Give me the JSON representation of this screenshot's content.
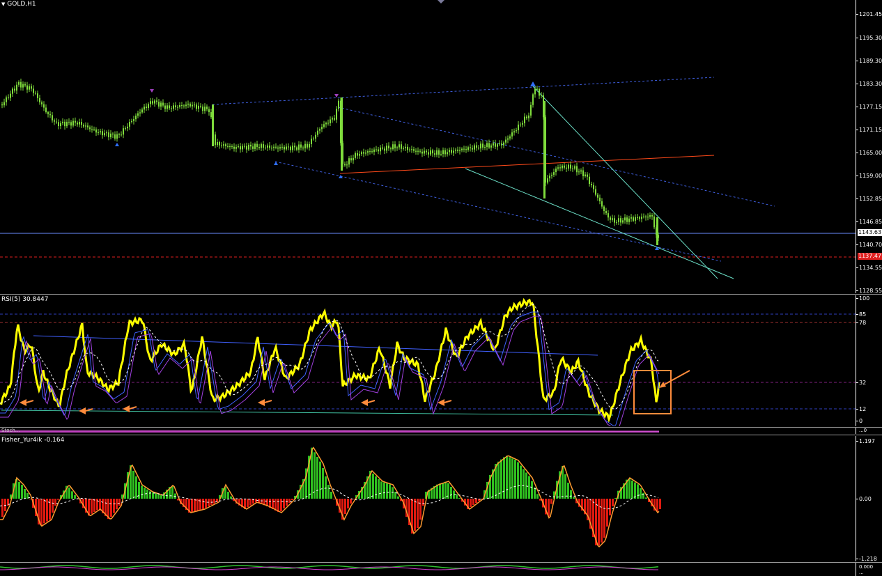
{
  "chart_window": {
    "menu_arrow": "dropdown-triangle",
    "symbol": "GOLD,H1"
  },
  "price_pane": {
    "price_ticks": [
      "1201.45",
      "1195.30",
      "1189.30",
      "1183.30",
      "1177.15",
      "1171.15",
      "1165.00",
      "1159.00",
      "1152.85",
      "1146.85",
      "1140.70",
      "1134.55",
      "1128.55"
    ],
    "current_price_label": "1143.63",
    "alert_price_label": "1137.47",
    "colors": {
      "bull_candle": "#7fdc3c",
      "trend_dotted": "#3f5fe0",
      "red_line": "#ff4a1a",
      "cyan_line": "#6ce0c8",
      "fractal_up": "#a040c0",
      "fractal_down": "#3070ff",
      "alert_line": "#e02020"
    }
  },
  "rsi_pane": {
    "title": "RSI(5) 30.8447",
    "levels": [
      "100",
      "85",
      "78",
      "32",
      "12",
      "0"
    ],
    "colors": {
      "rsi_line": "#ffff00",
      "signal_blue": "#4060ff",
      "signal_purple": "#a040e0",
      "ma_dashed": "#ffffff",
      "annotation": "#ff8c3c"
    }
  },
  "mini_pane": {
    "title": "Stoch...",
    "ticks": [
      "0"
    ],
    "scale_tail": "...0"
  },
  "fisher_pane": {
    "title": "Fisher_Yur4ik -0.164",
    "ticks": [
      "1.197",
      "0.00",
      "-1.218"
    ],
    "colors": {
      "pos_hist": "#30c020",
      "neg_hist": "#e01a10",
      "signal": "#ff9a30",
      "zero_dashed": "#ffffff"
    }
  },
  "bottom_pane": {
    "ticks": [
      "0.000",
      "..."
    ]
  }
}
